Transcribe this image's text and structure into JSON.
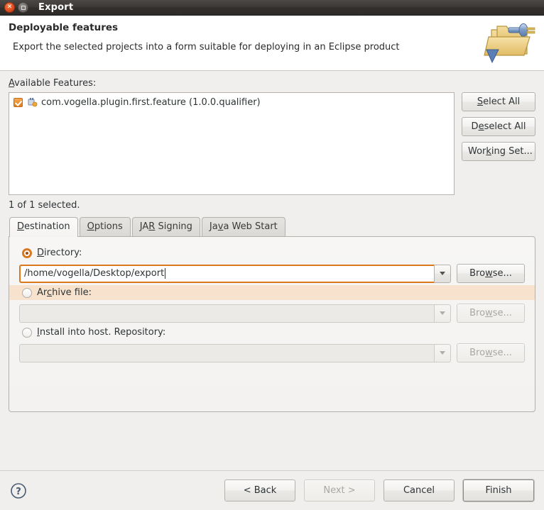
{
  "window": {
    "title": "Export",
    "close_icon": "close-icon",
    "maximize_icon": "maximize-icon"
  },
  "header": {
    "title": "Deployable features",
    "description": "Export the selected projects into a form suitable for deploying in an Eclipse product",
    "icon": "export-folder-plug-icon"
  },
  "features": {
    "label_prefix": "A",
    "label_rest": "vailable Features:",
    "items": [
      {
        "name": "com.vogella.plugin.first.feature (1.0.0.qualifier)",
        "checked": true,
        "icon": "feature-plugin-icon"
      }
    ],
    "selection_status": "1 of 1 selected.",
    "buttons": [
      {
        "pre": "",
        "mn": "S",
        "post": "elect All",
        "name": "select-all-button"
      },
      {
        "pre": "D",
        "mn": "e",
        "post": "select All",
        "name": "deselect-all-button"
      },
      {
        "pre": "Wor",
        "mn": "k",
        "post": "ing Set...",
        "name": "working-set-button"
      }
    ]
  },
  "tabs": [
    {
      "pre": "",
      "mn": "D",
      "post": "estination",
      "active": true,
      "name": "tab-destination"
    },
    {
      "pre": "",
      "mn": "O",
      "post": "ptions",
      "active": false,
      "name": "tab-options"
    },
    {
      "pre": "JA",
      "mn": "R",
      "post": " Signing",
      "active": false,
      "name": "tab-jar-signing"
    },
    {
      "pre": "Ja",
      "mn": "v",
      "post": "a Web Start",
      "active": false,
      "name": "tab-java-web-start"
    }
  ],
  "destination": {
    "directory": {
      "pre": "",
      "mn": "D",
      "post": "irectory:",
      "selected": true,
      "value": "/home/vogella/Desktop/export",
      "browse_pre": "Bro",
      "browse_mn": "w",
      "browse_post": "se...",
      "enabled": true
    },
    "archive": {
      "pre": "Ar",
      "mn": "c",
      "post": "hive file:",
      "selected": false,
      "value": "",
      "browse_pre": "Bro",
      "browse_mn": "w",
      "browse_post": "se...",
      "enabled": false,
      "highlighted": true
    },
    "repository": {
      "pre": "",
      "mn": "I",
      "post": "nstall into host. Repository:",
      "selected": false,
      "value": "",
      "browse_pre": "Bro",
      "browse_mn": "w",
      "browse_post": "se...",
      "enabled": false
    }
  },
  "footer": {
    "help_icon": "help-question-icon",
    "buttons": [
      {
        "label": "< Back",
        "disabled": false,
        "default": false,
        "name": "back-button"
      },
      {
        "label": "Next >",
        "disabled": true,
        "default": false,
        "name": "next-button"
      },
      {
        "label": "Cancel",
        "disabled": false,
        "default": false,
        "name": "cancel-button"
      },
      {
        "label": "Finish",
        "disabled": false,
        "default": true,
        "name": "finish-button"
      }
    ]
  },
  "colors": {
    "accent_orange": "#d9781e",
    "highlight_peach": "#f7e2cd",
    "titlebar_dark": "#3b3835",
    "close_red": "#df4b1f"
  }
}
